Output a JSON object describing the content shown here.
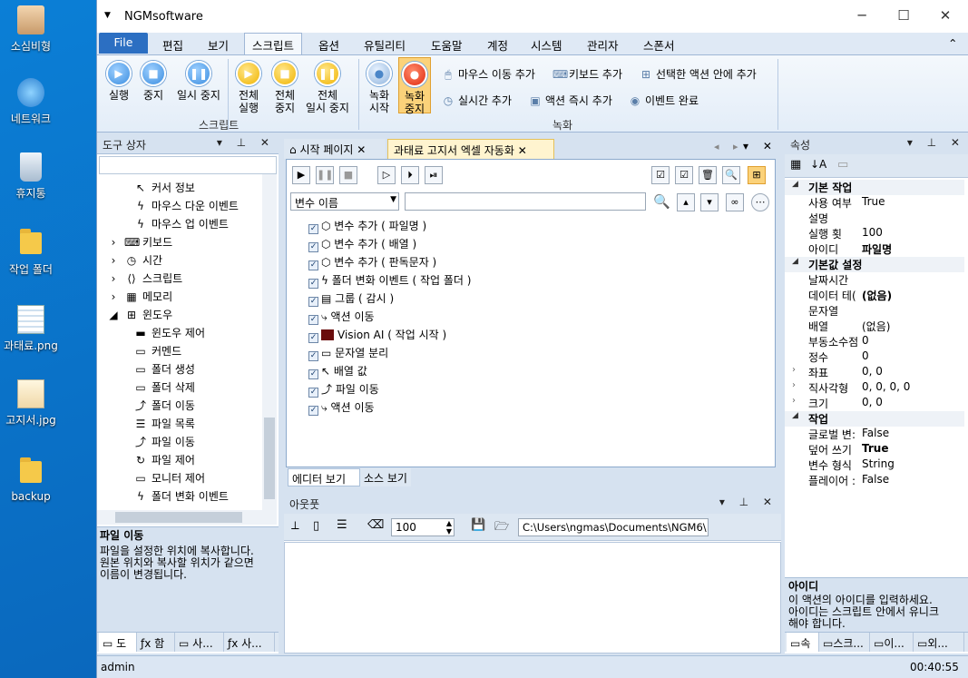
{
  "desktop": {
    "icons": [
      {
        "label": "소심비형"
      },
      {
        "label": "네트워크"
      },
      {
        "label": "휴지통"
      },
      {
        "label": "작업 폴더"
      },
      {
        "label": "과태료.png"
      },
      {
        "label": "고지서.jpg"
      },
      {
        "label": "backup"
      }
    ]
  },
  "window": {
    "title": "NGMsoftware",
    "minimize": "─",
    "maximize": "☐",
    "close": "✕"
  },
  "menu": {
    "file": "File",
    "items": [
      "편집",
      "보기",
      "스크립트",
      "옵션",
      "유틸리티",
      "도움말",
      "계정",
      "시스템",
      "관리자",
      "스폰서"
    ],
    "collapse": "⌃"
  },
  "ribbon": {
    "run": "실행",
    "stop": "중지",
    "pause": "일시 중지",
    "run_all_1": "전체",
    "run_all_2": "실행",
    "stop_all_1": "전체",
    "stop_all_2": "중지",
    "pause_all_1": "전체",
    "pause_all_2": "일시 중지",
    "script_group": "스크립트",
    "rec_start_1": "녹화",
    "rec_start_2": "시작",
    "rec_stop_1": "녹화",
    "rec_stop_2": "중지",
    "mouse_move": "마우스 이동 추가",
    "keyboard": "키보드 추가",
    "add_into_selected": "선택한 액션 안에 추가",
    "realtime": "실시간 추가",
    "action_instant": "액션 즉시 추가",
    "event_complete": "이벤트 완료",
    "record_group": "녹화"
  },
  "toolbox": {
    "title": "도구 상자",
    "items": [
      {
        "label": "커서 정보"
      },
      {
        "label": "마우스 다운 이벤트"
      },
      {
        "label": "마우스 업 이벤트"
      },
      {
        "label": "키보드"
      },
      {
        "label": "시간"
      },
      {
        "label": "스크립트"
      },
      {
        "label": "메모리"
      },
      {
        "label": "윈도우"
      },
      {
        "label": "윈도우 제어"
      },
      {
        "label": "커멘드"
      },
      {
        "label": "폴더 생성"
      },
      {
        "label": "폴더 삭제"
      },
      {
        "label": "폴더 이동"
      },
      {
        "label": "파일 목록"
      },
      {
        "label": "파일 이동"
      },
      {
        "label": "파일 제어"
      },
      {
        "label": "모니터 제어"
      },
      {
        "label": "폴더 변화 이벤트"
      }
    ],
    "desc_title": "파일 이동",
    "desc_lines": [
      "파일을 설정한 위치에 복사합니다.",
      "원본 위치와 복사할 위치가 같으면",
      "이름이 변경됩니다."
    ],
    "tabs": [
      "도",
      "함",
      "사...",
      "사..."
    ]
  },
  "doc": {
    "tab_start": "시작 페이지",
    "tab_active": "과태료 고지서 엑셀 자동화",
    "filter_label": "변수 이름",
    "rows": [
      {
        "label": "변수 추가 ( 파일명 )"
      },
      {
        "label": "변수 추가 ( 배열 )"
      },
      {
        "label": "변수 추가 ( 판독문자 )"
      },
      {
        "label": "폴더 변화 이벤트 ( 작업 폴더 )"
      },
      {
        "label": "그룹 ( 감시 )"
      },
      {
        "label": "액션 이동"
      },
      {
        "label": "Vision AI ( 작업 시작 )"
      },
      {
        "label": "문자열 분리"
      },
      {
        "label": "배열 값"
      },
      {
        "label": "파일 이동"
      },
      {
        "label": "액션 이동"
      }
    ],
    "view_tabs": [
      "에디터 보기",
      "소스 보기"
    ]
  },
  "output": {
    "title": "아웃풋",
    "value": "100",
    "path": "C:\\Users\\ngmas\\Documents\\NGM6\\"
  },
  "props": {
    "title": "속성",
    "cats": [
      "기본 작업",
      "기본값 설정",
      "작업"
    ],
    "basic": [
      {
        "k": "사용 여부",
        "v": "True"
      },
      {
        "k": "설명",
        "v": ""
      },
      {
        "k": "실행 횟",
        "v": "100"
      },
      {
        "k": "아이디",
        "v": "파일명"
      }
    ],
    "defaults": [
      {
        "k": "날짜시간",
        "v": ""
      },
      {
        "k": "데이터 테(",
        "v": "(없음)"
      },
      {
        "k": "문자열",
        "v": ""
      },
      {
        "k": "배열",
        "v": "(없음)"
      },
      {
        "k": "부동소수점",
        "v": "0"
      },
      {
        "k": "정수",
        "v": "0"
      },
      {
        "k": "좌표",
        "v": "0, 0"
      },
      {
        "k": "직사각형",
        "v": "0, 0, 0, 0"
      },
      {
        "k": "크기",
        "v": "0, 0"
      }
    ],
    "work": [
      {
        "k": "글로벌 변:",
        "v": "False"
      },
      {
        "k": "덮어 쓰기",
        "v": "True"
      },
      {
        "k": "변수 형식",
        "v": "String"
      },
      {
        "k": "플레이어 :",
        "v": "False"
      }
    ],
    "desc_title": "아이디",
    "desc_lines": [
      "이 액션의 아이디를 입력하세요.",
      "아이디는 스크립트 안에서 유니크",
      "해야 합니다."
    ],
    "tabs": [
      "속",
      "스크...",
      "이...",
      "외..."
    ]
  },
  "status": {
    "user": "admin",
    "time": "00:40:55"
  }
}
